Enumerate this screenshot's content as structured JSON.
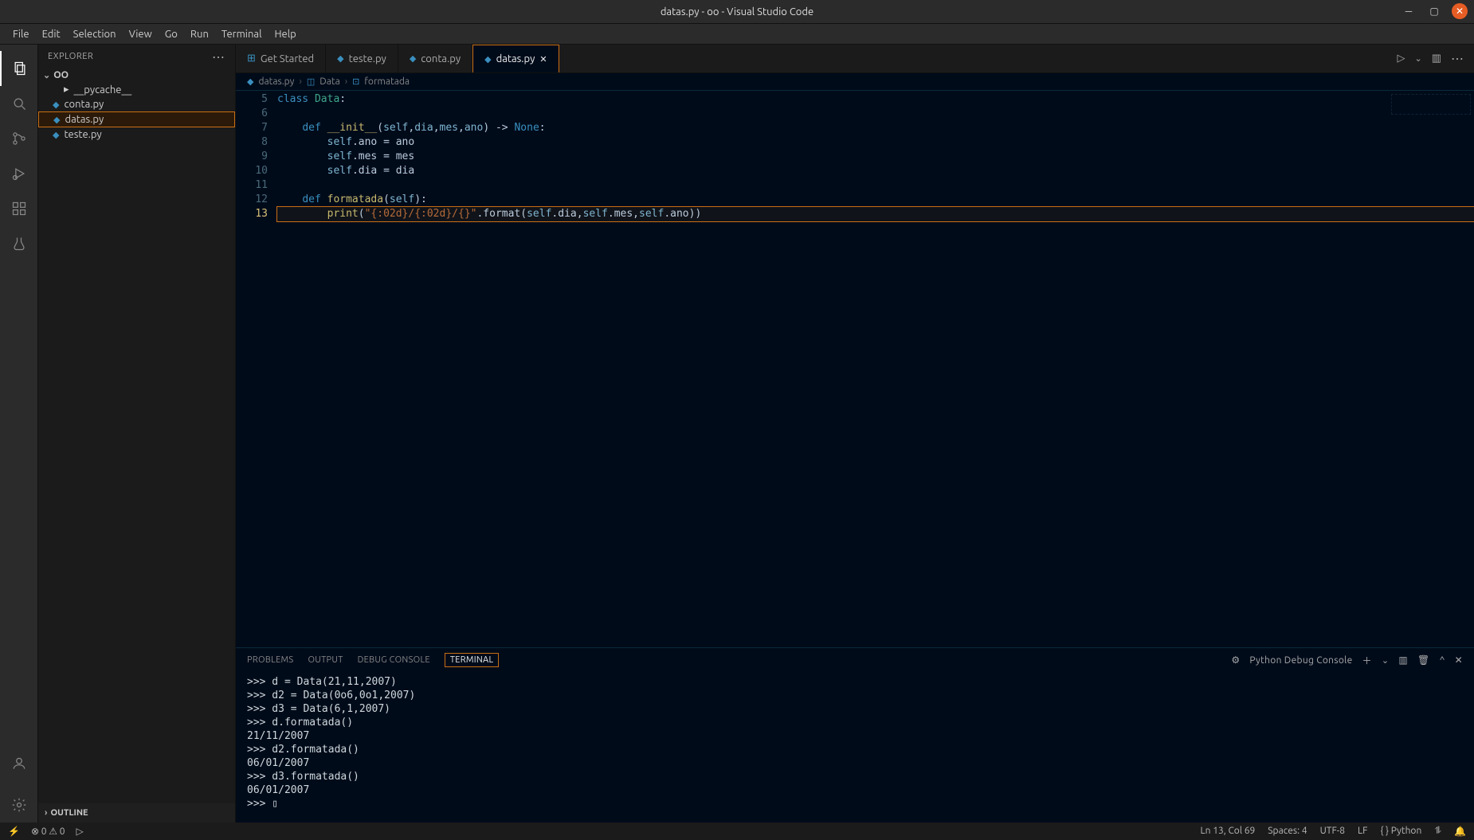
{
  "window": {
    "title": "datas.py - oo - Visual Studio Code"
  },
  "menubar": [
    "File",
    "Edit",
    "Selection",
    "View",
    "Go",
    "Run",
    "Terminal",
    "Help"
  ],
  "sidebar": {
    "title": "EXPLORER",
    "root": "OO",
    "items": [
      {
        "label": "__pycache__",
        "icon": "folder",
        "indent": true
      },
      {
        "label": "conta.py",
        "icon": "py"
      },
      {
        "label": "datas.py",
        "icon": "py",
        "selected": true
      },
      {
        "label": "teste.py",
        "icon": "py"
      }
    ],
    "outline": "OUTLINE"
  },
  "tabs": [
    {
      "label": "Get Started",
      "icon": "vscode"
    },
    {
      "label": "teste.py",
      "icon": "py"
    },
    {
      "label": "conta.py",
      "icon": "py"
    },
    {
      "label": "datas.py",
      "icon": "py",
      "active": true,
      "close": true
    }
  ],
  "breadcrumb": [
    {
      "label": "datas.py",
      "icon": "py"
    },
    {
      "label": "Data",
      "icon": "class"
    },
    {
      "label": "formatada",
      "icon": "method"
    }
  ],
  "code_lines": [
    {
      "n": 5,
      "html": "<span class='kw'>class</span> <span class='cls'>Data</span><span class='gen'>:</span>"
    },
    {
      "n": 6,
      "html": ""
    },
    {
      "n": 7,
      "html": "    <span class='kw'>def</span> <span class='fn'>__init__</span><span class='gen'>(</span><span class='par'>self</span><span class='gen'>,</span><span class='par'>dia</span><span class='gen'>,</span><span class='par'>mes</span><span class='gen'>,</span><span class='par'>ano</span><span class='gen'>) -> </span><span class='none'>None</span><span class='gen'>:</span>"
    },
    {
      "n": 8,
      "html": "        <span class='par'>self</span><span class='gen'>.ano = ano</span>"
    },
    {
      "n": 9,
      "html": "        <span class='par'>self</span><span class='gen'>.mes = mes</span>"
    },
    {
      "n": 10,
      "html": "        <span class='par'>self</span><span class='gen'>.dia = dia</span>"
    },
    {
      "n": 11,
      "html": ""
    },
    {
      "n": 12,
      "html": "    <span class='kw'>def</span> <span class='fn'>formatada</span><span class='gen'>(</span><span class='par'>self</span><span class='gen'>):</span>"
    },
    {
      "n": 13,
      "hl": true,
      "html": "        <span class='fn'>print</span><span class='gen'>(</span><span class='str'>\"{:02d}/{:02d}/{}\"</span><span class='gen'>.format(</span><span class='par'>self</span><span class='gen'>.dia,</span><span class='par'>self</span><span class='gen'>.mes,</span><span class='par'>self</span><span class='gen'>.ano))</span>"
    }
  ],
  "panel": {
    "tabs": [
      "PROBLEMS",
      "OUTPUT",
      "DEBUG CONSOLE",
      "TERMINAL"
    ],
    "active": 3,
    "profile": "Python Debug Console",
    "body": ">>> d = Data(21,11,2007)\n>>> d2 = Data(0o6,0o1,2007)\n>>> d3 = Data(6,1,2007)\n>>> d.formatada()\n21/11/2007\n>>> d2.formatada()\n06/01/2007\n>>> d3.formatada()\n06/01/2007\n>>> ▯"
  },
  "status": {
    "errors": "⊗ 0 ⚠ 0",
    "cursor": "Ln 13, Col 69",
    "spaces": "Spaces: 4",
    "encoding": "UTF-8",
    "eol": "LF",
    "lang": "{ } Python",
    "feedback": "⥮",
    "bell": "🔔"
  }
}
